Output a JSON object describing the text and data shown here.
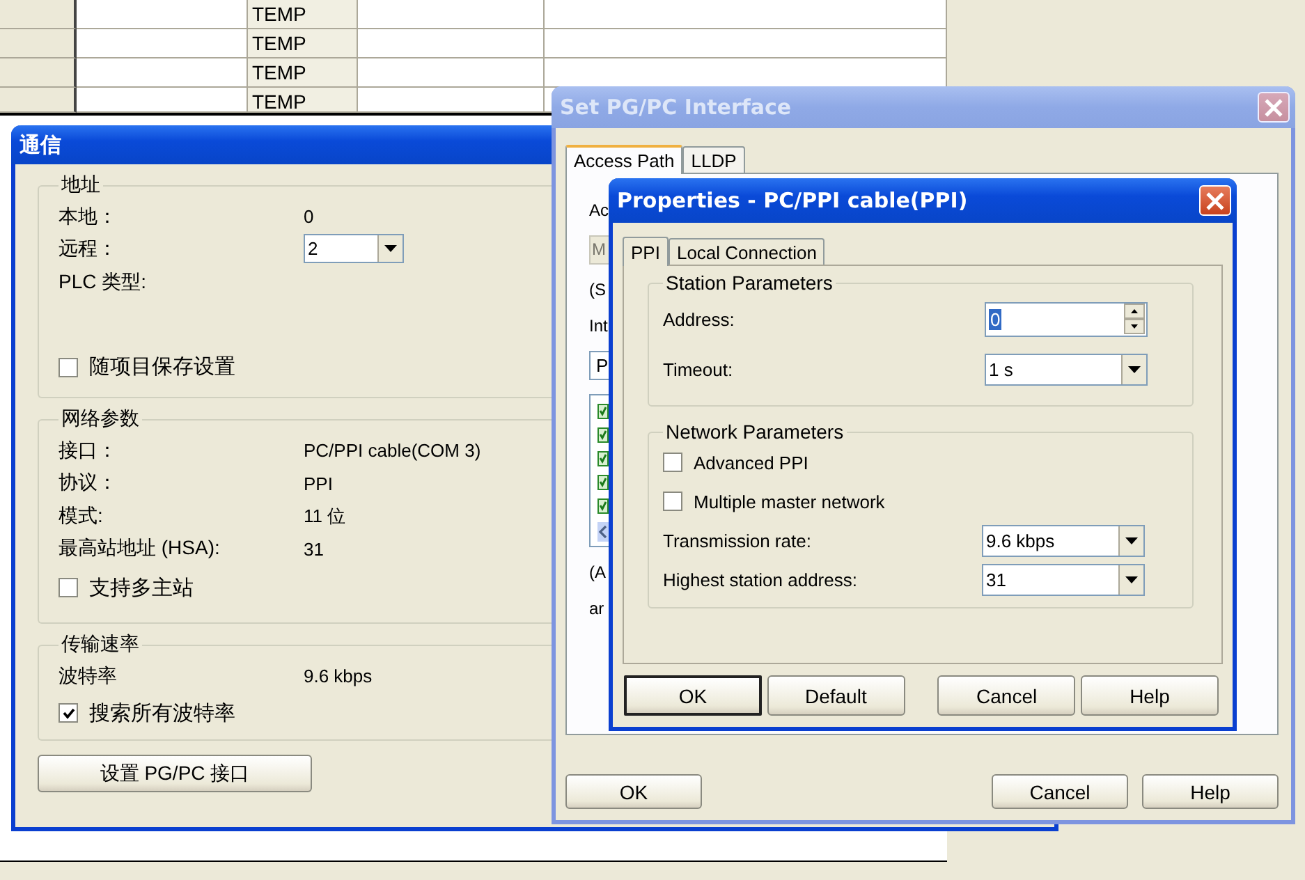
{
  "background_table": {
    "rows": [
      {
        "column_3": "TEMP"
      },
      {
        "column_3": "TEMP"
      },
      {
        "column_3": "TEMP"
      },
      {
        "column_3": "TEMP"
      }
    ]
  },
  "comm_window": {
    "title": "通信",
    "active": true,
    "groups": [
      {
        "title": "地址",
        "rows": [
          {
            "kind": "pair",
            "label": "本地：",
            "value": "0"
          },
          {
            "kind": "dropdown",
            "label": "远程：",
            "value": "2"
          },
          {
            "kind": "label",
            "label": "PLC 类型:"
          },
          {
            "kind": "checkbox",
            "label": "随项目保存设置",
            "checked": false
          }
        ]
      },
      {
        "title": "网络参数",
        "rows": [
          {
            "kind": "pair",
            "label": "接口：",
            "value": "PC/PPI cable(COM 3)"
          },
          {
            "kind": "pair",
            "label": "协议：",
            "value": "PPI"
          },
          {
            "kind": "pair",
            "label": "模式:",
            "value": "11 位"
          },
          {
            "kind": "pair",
            "label": "最高站地址 (HSA):",
            "value": "31"
          },
          {
            "kind": "checkbox",
            "label": "支持多主站",
            "checked": false
          }
        ]
      },
      {
        "title": "传输速率",
        "rows": [
          {
            "kind": "pair",
            "label": "波特率",
            "value": "9.6 kbps"
          },
          {
            "kind": "checkbox",
            "label": "搜索所有波特率",
            "checked": true
          }
        ]
      }
    ],
    "button": "设置 PG/PC 接口"
  },
  "pgpc_window": {
    "title": "Set PG/PC Interface",
    "active": false,
    "tabs": [
      {
        "label": "Access Path",
        "selected": true
      },
      {
        "label": "LLDP",
        "selected": false
      }
    ],
    "fragments": [
      {
        "kind": "text",
        "text": "Ac"
      },
      {
        "kind": "field",
        "text": "M",
        "disabled": true
      },
      {
        "kind": "text",
        "text": "(S"
      },
      {
        "kind": "text",
        "text": "Int"
      },
      {
        "kind": "field",
        "text": "P",
        "disabled": false
      },
      {
        "kind": "list"
      },
      {
        "kind": "text",
        "text": "(A"
      },
      {
        "kind": "text",
        "text": "ar"
      }
    ],
    "buttons": [
      {
        "label": "OK"
      },
      {
        "label": "Cancel"
      },
      {
        "label": "Help"
      }
    ]
  },
  "properties_window": {
    "title": "Properties - PC/PPI cable(PPI)",
    "active": true,
    "tabs": [
      {
        "label": "PPI",
        "selected": true
      },
      {
        "label": "Local Connection",
        "selected": false
      }
    ],
    "groups": [
      {
        "title": "Station Parameters",
        "rows": [
          {
            "kind": "spin",
            "label": "Address:",
            "value": "0",
            "text_selected": true
          },
          {
            "kind": "dropdown",
            "label": "Timeout:",
            "value": "1 s"
          }
        ]
      },
      {
        "title": "Network Parameters",
        "rows": [
          {
            "kind": "checkbox",
            "label": "Advanced PPI",
            "checked": false
          },
          {
            "kind": "checkbox",
            "label": "Multiple master network",
            "checked": false
          },
          {
            "kind": "dropdown",
            "label": "Transmission rate:",
            "value": "9.6 kbps"
          },
          {
            "kind": "dropdown",
            "label": "Highest station address:",
            "value": "31"
          }
        ]
      }
    ],
    "buttons": [
      {
        "label": "OK",
        "default": true
      },
      {
        "label": "Default",
        "default": false
      },
      {
        "label": "Cancel",
        "default": false
      },
      {
        "label": "Help",
        "default": false
      }
    ]
  }
}
